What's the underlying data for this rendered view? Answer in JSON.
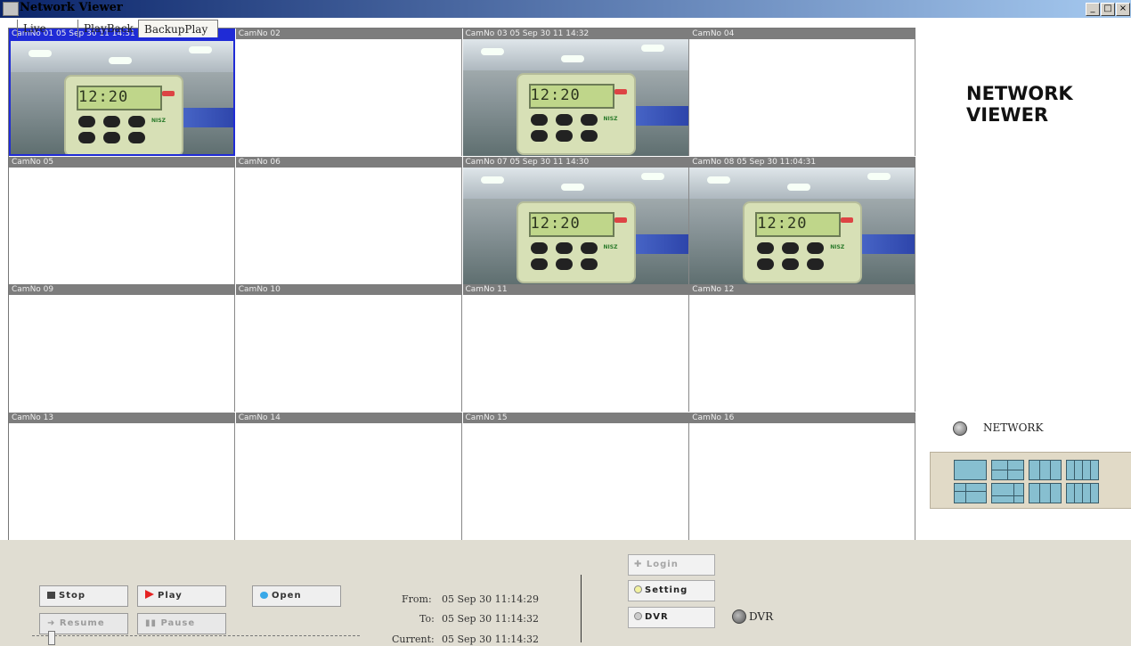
{
  "window": {
    "title": "Network Viewer",
    "minimize_glyph": "_",
    "maximize_glyph": "□",
    "close_glyph": "×"
  },
  "cameras": [
    {
      "label": "CamNo 01 05 Sep 30 11 14:31",
      "active": true,
      "feed": true
    },
    {
      "label": "CamNo 02",
      "active": false,
      "feed": false
    },
    {
      "label": "CamNo 03 05 Sep 30 11 14:32",
      "active": false,
      "feed": true
    },
    {
      "label": "CamNo 04",
      "active": false,
      "feed": false
    },
    {
      "label": "CamNo 05",
      "active": false,
      "feed": false
    },
    {
      "label": "CamNo 06",
      "active": false,
      "feed": false
    },
    {
      "label": "CamNo 07 05 Sep 30 11 14:30",
      "active": false,
      "feed": true
    },
    {
      "label": "CamNo 08 05 Sep 30 11:04:31",
      "active": false,
      "feed": true
    },
    {
      "label": "CamNo 09",
      "active": false,
      "feed": false
    },
    {
      "label": "CamNo 10",
      "active": false,
      "feed": false
    },
    {
      "label": "CamNo 11",
      "active": false,
      "feed": false
    },
    {
      "label": "CamNo 12",
      "active": false,
      "feed": false
    },
    {
      "label": "CamNo 13",
      "active": false,
      "feed": false
    },
    {
      "label": "CamNo 14",
      "active": false,
      "feed": false
    },
    {
      "label": "CamNo 15",
      "active": false,
      "feed": false
    },
    {
      "label": "CamNo 16",
      "active": false,
      "feed": false
    }
  ],
  "feed_display": {
    "clock_text": "12:20",
    "brand_text": "NISZ"
  },
  "brand": {
    "line1": "NETWORK",
    "line2": "VIEWER"
  },
  "network_option": {
    "label": "NETWORK"
  },
  "tabs": [
    {
      "label": "Live",
      "selected": false
    },
    {
      "label": "PlayBack",
      "selected": false
    },
    {
      "label": "BackupPlay",
      "selected": true
    }
  ],
  "controls": {
    "stop": "Stop",
    "play": "Play",
    "open": "Open",
    "resume": "Resume",
    "pause": "Pause"
  },
  "time_info": {
    "from_label": "From:",
    "from_value": "05 Sep 30 11:14:29",
    "to_label": "To:",
    "to_value": "05 Sep 30 11:14:32",
    "current_label": "Current:",
    "current_value": "05 Sep 30 11:14:32"
  },
  "right_controls": {
    "login": "Login",
    "setting": "Setting",
    "dvr": "DVR",
    "dvr_option": "DVR"
  },
  "colors": {
    "title_bar": "#0a246a",
    "active_camera": "#1f2bd6",
    "camera_header": "#7d7d7d",
    "layout_button": "#87bfd0",
    "panel_bg": "#e0ddd2"
  }
}
